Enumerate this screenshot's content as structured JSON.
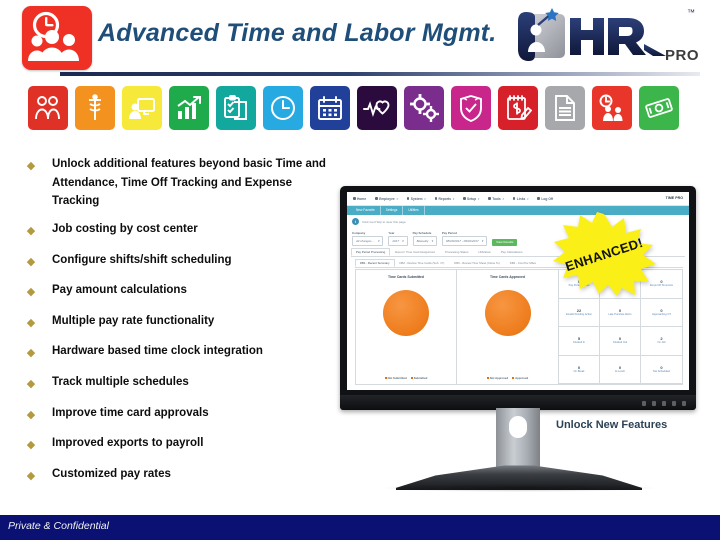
{
  "header": {
    "title": "Advanced Time and Labor Mgmt.",
    "brand_icon": "clock-people-icon",
    "logo": {
      "name": "hr-pro-logo",
      "mark": "HR",
      "sub": "PRO",
      "tm": "™"
    },
    "rule_color": "#1b2a52",
    "icon_bg": "#ee3124"
  },
  "icon_strip": [
    {
      "name": "people-icon",
      "color": "#e03127"
    },
    {
      "name": "caduceus-medical-icon",
      "color": "#f3921f"
    },
    {
      "name": "person-monitor-icon",
      "color": "#f7e93a"
    },
    {
      "name": "bar-chart-growth-icon",
      "color": "#1faa4b"
    },
    {
      "name": "clipboard-checklist-icon",
      "color": "#12a89d"
    },
    {
      "name": "clock-icon",
      "color": "#27a9e1"
    },
    {
      "name": "calendar-icon",
      "color": "#21409a"
    },
    {
      "name": "heartbeat-icon",
      "color": "#2b0a3d"
    },
    {
      "name": "gears-settings-icon",
      "color": "#7b2d8e"
    },
    {
      "name": "shield-check-icon",
      "color": "#c9268b"
    },
    {
      "name": "notepad-dollar-pencil-icon",
      "color": "#d6202a"
    },
    {
      "name": "document-lines-icon",
      "color": "#a6a8ab"
    },
    {
      "name": "clock-worker-icon",
      "color": "#e8372a"
    },
    {
      "name": "money-cash-icon",
      "color": "#3cb54a"
    }
  ],
  "bullets": {
    "marker": "◆",
    "marker_color": "#b39a3f",
    "items": [
      "Unlock additional features beyond basic Time and Attendance, Time Off Tracking and Expense Tracking",
      "Job costing by cost center",
      "Configure shifts/shift scheduling",
      "Pay amount calculations",
      "Multiple pay rate functionality",
      "Hardware based time clock integration",
      "Track multiple schedules",
      "Improve time card approvals",
      "Improved exports to payroll",
      "Customized pay rates"
    ]
  },
  "badge": {
    "label": "ENHANCED!",
    "fill": "#faf017",
    "text_color": "#111111"
  },
  "caption": "Unlock New Features",
  "screenshot": {
    "nav": [
      {
        "label": "Home",
        "icon": "home-icon",
        "caret": false
      },
      {
        "label": "Employee",
        "icon": "person-icon",
        "caret": true
      },
      {
        "label": "System",
        "icon": "monitor-icon",
        "caret": true
      },
      {
        "label": "Reports",
        "icon": "grid-icon",
        "caret": true
      },
      {
        "label": "Setup",
        "icon": "gear-icon",
        "caret": true
      },
      {
        "label": "Tools",
        "icon": "wrench-icon",
        "caret": true
      },
      {
        "label": "Links",
        "icon": "book-icon",
        "caret": true
      },
      {
        "label": "Log Off",
        "icon": "exit-icon",
        "caret": false
      }
    ],
    "brand": "TIME PRO",
    "subnav": [
      "New Favorite",
      "Settings",
      "Utilities"
    ],
    "help_badge": "i",
    "help_text": "Click Get Help to view this page",
    "filters": [
      {
        "label": "Company",
        "value": "All changes ..."
      },
      {
        "label": "Year",
        "value": "2017"
      },
      {
        "label": "Pay Schedule",
        "value": "Biweekly"
      },
      {
        "label": "Pay Period",
        "value": "08/20/2017 - 09/02/2017"
      }
    ],
    "filter_button": "View Results",
    "tabs": [
      {
        "label": "Pay Period Processing",
        "active": true
      },
      {
        "label": "Export / Time Card Assignment",
        "active": false
      },
      {
        "label": "Processing Status",
        "active": false
      },
      {
        "label": "Utilization",
        "active": false
      },
      {
        "label": "Pay Calculations",
        "active": false
      }
    ],
    "subtabs": [
      {
        "label": "DB1 - Recent Summary",
        "active": true
      },
      {
        "label": "DB2 - Review Time Cards (Sub. / P)",
        "active": false
      },
      {
        "label": "DB3 - Review Time Sheet (Close To)",
        "active": false
      },
      {
        "label": "DB4 - Cost Per Miles",
        "active": false
      }
    ],
    "panels": [
      {
        "title": "Time Cards Submitted",
        "chart": "pie",
        "legend": [
          "Not Submitted",
          "Submitted"
        ]
      },
      {
        "title": "Time Cards Approved",
        "chart": "pie",
        "legend": [
          "Not Approved",
          "Approved"
        ]
      }
    ],
    "stats": [
      {
        "value": "0",
        "label": "Pay Period Status"
      },
      {
        "value": "0",
        "label": "Emps Off Today"
      },
      {
        "value": "0",
        "label": "Emps Off Tomorrow"
      },
      {
        "value": "22",
        "label": "Emails Pending Action"
      },
      {
        "value": "0",
        "label": "Late Punches Alerts"
      },
      {
        "value": "0",
        "label": "Approaching OT"
      },
      {
        "value": "5",
        "label": "Clocked In"
      },
      {
        "value": "0",
        "label": "Clocked Out"
      },
      {
        "value": "2",
        "label": "On Job"
      },
      {
        "value": "0",
        "label": "On Break"
      },
      {
        "value": "0",
        "label": "At Lunch"
      },
      {
        "value": "0",
        "label": "Not Scheduled"
      }
    ],
    "pie_color": "#ef7f20",
    "subnav_color": "#4bacc6"
  },
  "footer": {
    "text": "Private & Confidential",
    "bg": "#0b1173"
  }
}
